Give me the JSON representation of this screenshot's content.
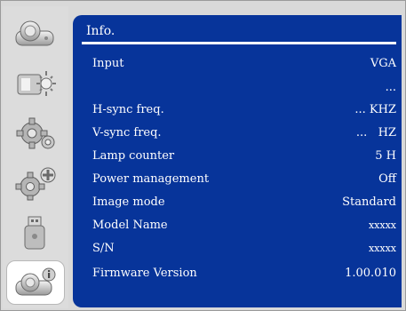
{
  "sidebar": {
    "items": [
      {
        "name": "picture"
      },
      {
        "name": "setup"
      },
      {
        "name": "settings"
      },
      {
        "name": "advanced"
      },
      {
        "name": "usb"
      },
      {
        "name": "info"
      }
    ],
    "selected": "info"
  },
  "panel": {
    "title": "Info.",
    "rows": [
      {
        "label": "Input",
        "value": "VGA"
      },
      {
        "label": "",
        "value": "..."
      },
      {
        "label": "H-sync freq.",
        "value": "... KHZ"
      },
      {
        "label": "V-sync freq.",
        "value": "...   HZ"
      },
      {
        "label": "Lamp counter",
        "value": "5 H"
      },
      {
        "label": "Power management",
        "value": "Off"
      },
      {
        "label": "Image mode",
        "value": "Standard"
      },
      {
        "label": "Model Name",
        "value": "xxxxx"
      },
      {
        "label": "S/N",
        "value": "xxxxx"
      },
      {
        "label": "Firmware Version",
        "value": "1.00.010"
      }
    ]
  },
  "colors": {
    "panel_bg": "#07349a",
    "sidebar_bg": "#dcdcdc",
    "text": "#ffffff"
  }
}
